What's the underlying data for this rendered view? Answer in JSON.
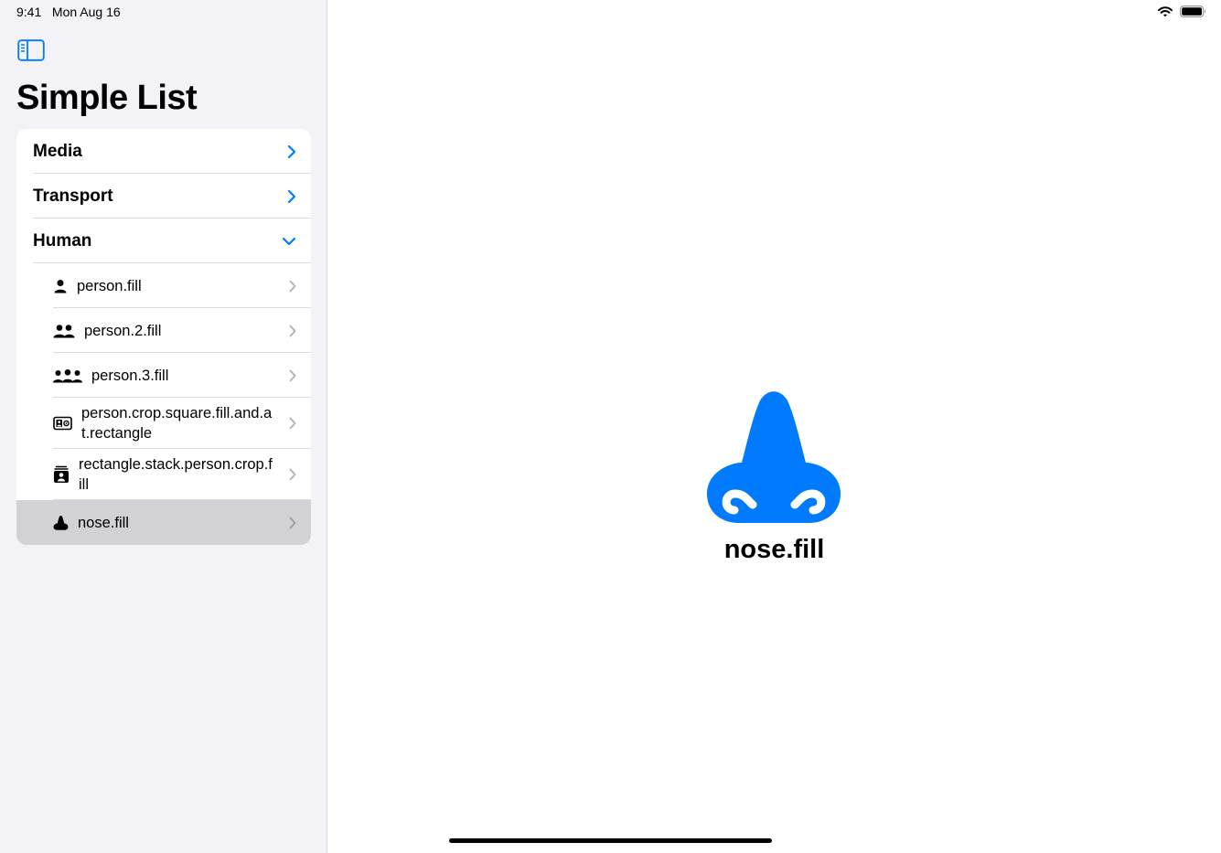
{
  "status": {
    "time": "9:41",
    "date": "Mon Aug 16"
  },
  "sidebar": {
    "title": "Simple List",
    "sections": [
      {
        "label": "Media",
        "state": "collapsed"
      },
      {
        "label": "Transport",
        "state": "collapsed"
      },
      {
        "label": "Human",
        "state": "expanded"
      }
    ],
    "items": [
      {
        "label": "person.fill",
        "icon": "person-fill-icon"
      },
      {
        "label": "person.2.fill",
        "icon": "person-2-fill-icon"
      },
      {
        "label": "person.3.fill",
        "icon": "person-3-fill-icon"
      },
      {
        "label": "person.crop.square.fill.and.at.rectangle",
        "icon": "contact-card-icon"
      },
      {
        "label": "rectangle.stack.person.crop.fill",
        "icon": "rectangle-stack-person-icon"
      },
      {
        "label": "nose.fill",
        "icon": "nose-fill-icon",
        "selected": true
      }
    ]
  },
  "detail": {
    "caption": "nose.fill",
    "icon": "nose-fill-icon"
  },
  "colors": {
    "accent": "#007aff",
    "sidebar_bg": "#f2f2f7",
    "selection": "#d1d1d6"
  }
}
